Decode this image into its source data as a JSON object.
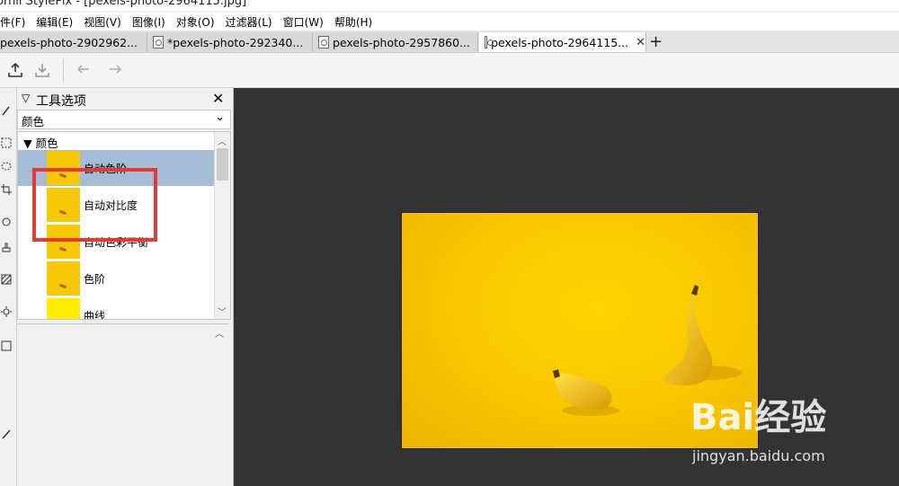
{
  "window": {
    "title": "ornil StylePix - [pexels-photo-2964115.jpg]"
  },
  "menu": [
    "件(F)",
    "编辑(E)",
    "视图(V)",
    "图像(I)",
    "对象(O)",
    "过滤器(L)",
    "窗口(W)",
    "帮助(H)"
  ],
  "tabs": [
    {
      "label": "pexels-photo-2902962...",
      "active": false
    },
    {
      "label": "*pexels-photo-292340...",
      "active": false
    },
    {
      "label": "pexels-photo-2957860...",
      "active": false
    },
    {
      "label": "pexels-photo-2964115...",
      "active": true
    }
  ],
  "panel": {
    "title": "工具选项",
    "category": "颜色",
    "group_header": "颜色",
    "items": [
      {
        "label": "自动色阶",
        "selected": true
      },
      {
        "label": "自动对比度",
        "selected": false
      },
      {
        "label": "自动色彩平衡",
        "selected": false
      },
      {
        "label": "色阶",
        "selected": false
      },
      {
        "label": "曲线",
        "selected": false
      }
    ]
  },
  "watermark": {
    "brand": "Bai经验",
    "url": "jingyan.baidu.com"
  },
  "colors": {
    "canvas": "#333333",
    "highlight": "#e53935",
    "selected_row": "#a4bcd6",
    "photo": "#f8c400"
  }
}
